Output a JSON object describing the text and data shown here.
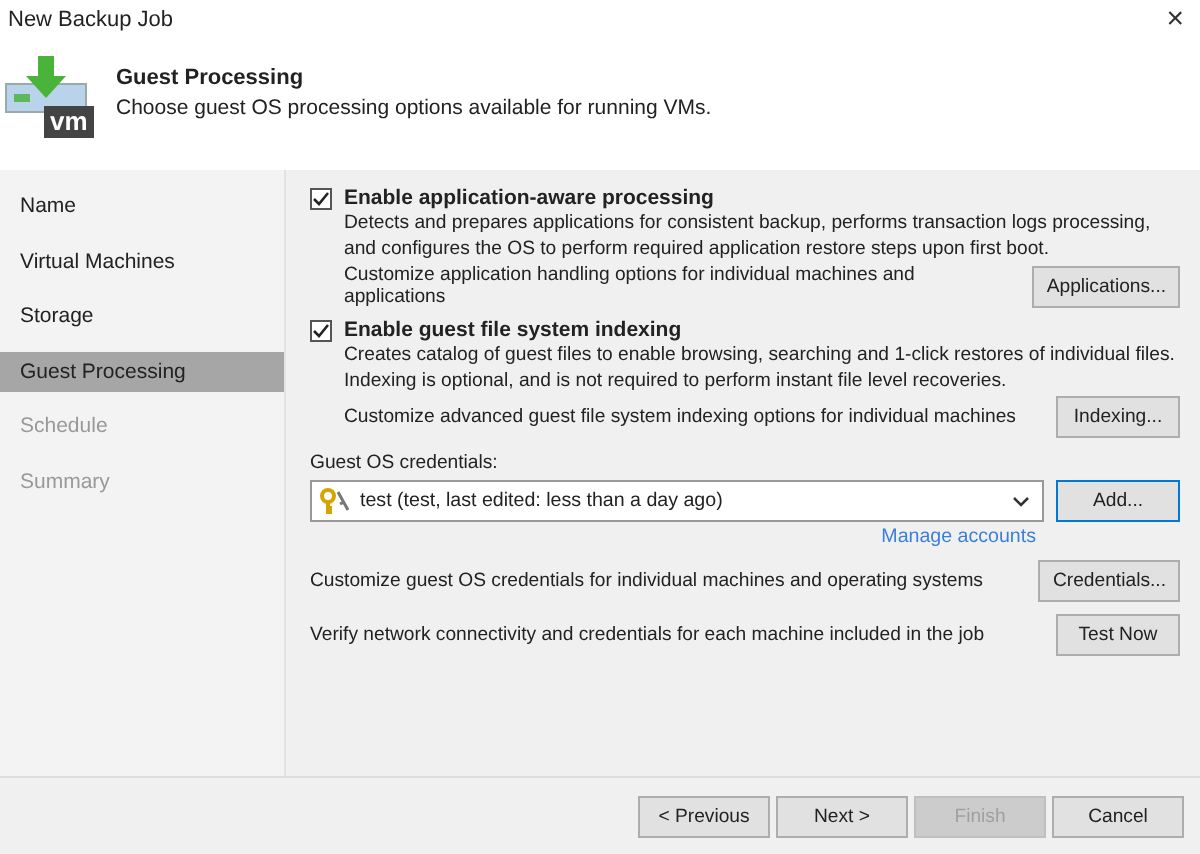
{
  "window": {
    "title": "New Backup Job",
    "close": "×"
  },
  "header": {
    "title": "Guest Processing",
    "subtitle": "Choose guest OS processing options available for running VMs.",
    "icon_text": "vm"
  },
  "sidebar": {
    "items": [
      {
        "label": "Name",
        "selected": false,
        "disabled": false
      },
      {
        "label": "Virtual Machines",
        "selected": false,
        "disabled": false
      },
      {
        "label": "Storage",
        "selected": false,
        "disabled": false
      },
      {
        "label": "Guest Processing",
        "selected": true,
        "disabled": false
      },
      {
        "label": "Schedule",
        "selected": false,
        "disabled": true
      },
      {
        "label": "Summary",
        "selected": false,
        "disabled": true
      }
    ]
  },
  "options": [
    {
      "label": "Enable application-aware processing",
      "checked": true,
      "description": "Detects and prepares applications for consistent backup, performs transaction logs processing, and configures the OS to perform required application restore steps upon first boot.",
      "customize_text": "Customize application handling options for individual machines and applications",
      "button": "Applications..."
    },
    {
      "label": "Enable guest file system indexing",
      "checked": true,
      "description": "Creates catalog of guest files to enable browsing, searching and 1-click restores of individual files. Indexing is optional, and is not required to perform instant file level recoveries.",
      "customize_text": "Customize advanced guest file system indexing options for individual machines",
      "button": "Indexing..."
    }
  ],
  "credentials": {
    "label": "Guest OS credentials:",
    "value": "test (test, last edited: less than a day ago)",
    "add_button": "Add...",
    "manage_link": "Manage accounts"
  },
  "actions": [
    {
      "text": "Customize guest OS credentials for individual machines and operating systems",
      "button": "Credentials..."
    },
    {
      "text": "Verify network connectivity and credentials for each machine included in the job",
      "button": "Test Now"
    }
  ],
  "footer": {
    "buttons": [
      {
        "label": "< Previous",
        "disabled": false
      },
      {
        "label": "Next >",
        "disabled": false
      },
      {
        "label": "Finish",
        "disabled": true
      },
      {
        "label": "Cancel",
        "disabled": false
      }
    ]
  }
}
